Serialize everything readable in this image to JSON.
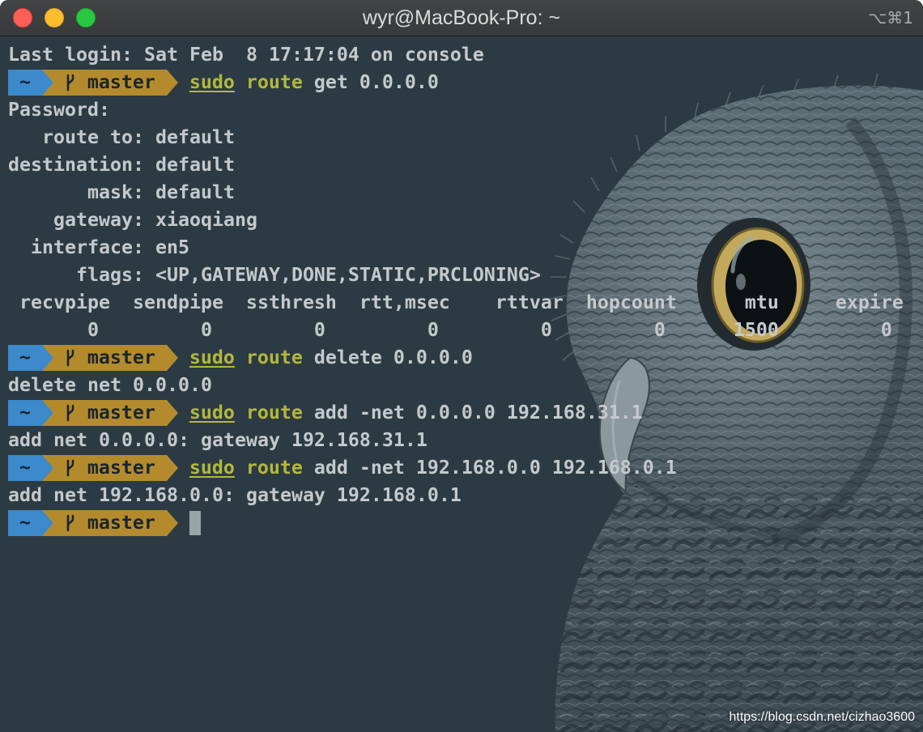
{
  "window": {
    "title": "wyr@MacBook-Pro: ~",
    "shortcut": "⌥⌘1",
    "traffic_lights": {
      "close": "#ff5f57",
      "minimize": "#febc2e",
      "zoom": "#28c840"
    }
  },
  "theme": {
    "background": "#2c3b43",
    "foreground": "#c3c9cc",
    "command": "#b3b83c",
    "prompt_dir_bg": "#3c89cb",
    "prompt_git_bg": "#b38b2d",
    "prompt_fg": "#1a2530",
    "cursor": "#98a4aa"
  },
  "terminal": {
    "last_login": "Last login: Sat Feb  8 17:17:04 on console",
    "prompt": {
      "dir": "~",
      "branch_icon": "git-branch-icon",
      "branch": "master"
    },
    "commands": [
      {
        "precommand": "sudo",
        "command": "route",
        "args": "get 0.0.0.0",
        "output": [
          "Password:",
          "   route to: default",
          "destination: default",
          "       mask: default",
          "    gateway: xiaoqiang",
          "  interface: en5",
          "      flags: <UP,GATEWAY,DONE,STATIC,PRCLONING>",
          " recvpipe  sendpipe  ssthresh  rtt,msec    rttvar  hopcount      mtu     expire",
          "       0         0         0         0         0         0      1500         0"
        ]
      },
      {
        "precommand": "sudo",
        "command": "route",
        "args": "delete 0.0.0.0",
        "output": [
          "delete net 0.0.0.0"
        ]
      },
      {
        "precommand": "sudo",
        "command": "route",
        "args": "add -net 0.0.0.0 192.168.31.1",
        "output": [
          "add net 0.0.0.0: gateway 192.168.31.1"
        ]
      },
      {
        "precommand": "sudo",
        "command": "route",
        "args": "add -net 192.168.0.0 192.168.0.1",
        "output": [
          "add net 192.168.0.0: gateway 192.168.0.1"
        ]
      }
    ]
  },
  "watermark": "https://blog.csdn.net/cizhao3600"
}
